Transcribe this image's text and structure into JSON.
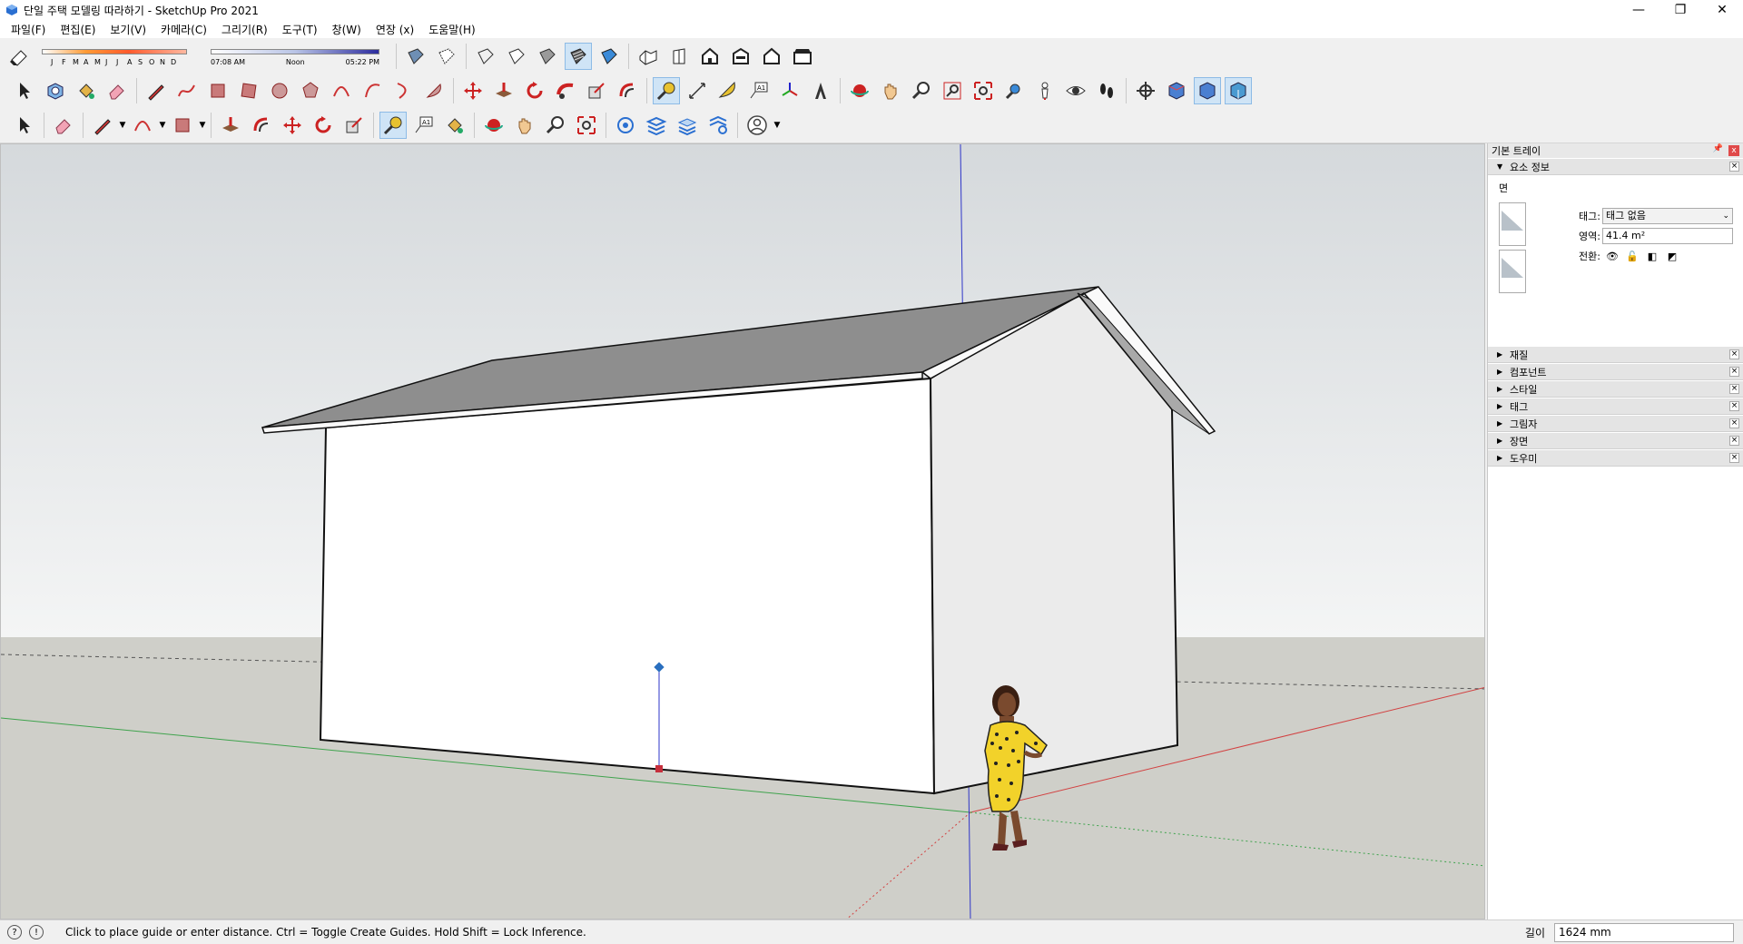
{
  "window": {
    "title": "단일 주택 모델링 따라하기 - SketchUp Pro 2021",
    "minimize": "—",
    "restore": "❐",
    "close": "✕"
  },
  "menu": [
    "파일(F)",
    "편집(E)",
    "보기(V)",
    "카메라(C)",
    "그리기(R)",
    "도구(T)",
    "창(W)",
    "연장 (x)",
    "도움말(H)"
  ],
  "shadows": {
    "months": [
      "J",
      "F",
      "M",
      "A",
      "M",
      "J",
      "J",
      "A",
      "S",
      "O",
      "N",
      "D"
    ],
    "time_start": "07:08 AM",
    "time_mid": "Noon",
    "time_end": "05:22 PM"
  },
  "tray": {
    "title": "기본 트레이",
    "pin": "📌",
    "close": "x",
    "entity_info": {
      "title": "요소 정보",
      "kind": "면",
      "tag_label": "태그:",
      "tag_value": "태그 없음",
      "area_label": "영역:",
      "area_value": "41.4 m²",
      "toggle_label": "전환:"
    },
    "panels": [
      "재질",
      "컴포넌트",
      "스타일",
      "태그",
      "그림자",
      "장면",
      "도우미"
    ]
  },
  "status": {
    "message": "Click to place guide or enter distance. Ctrl = Toggle Create Guides. Hold Shift = Lock Inference.",
    "measure_label": "길이",
    "measure_value": "1624 mm"
  },
  "colors": {
    "sky": "#d8dde0",
    "ground": "#cfcfc9",
    "roof": "#8e8e8e",
    "wall_front": "#ffffff",
    "wall_side": "#ebebeb",
    "axis_red": "#d24141",
    "axis_green": "#3fa34d",
    "axis_blue": "#2e35c8"
  }
}
